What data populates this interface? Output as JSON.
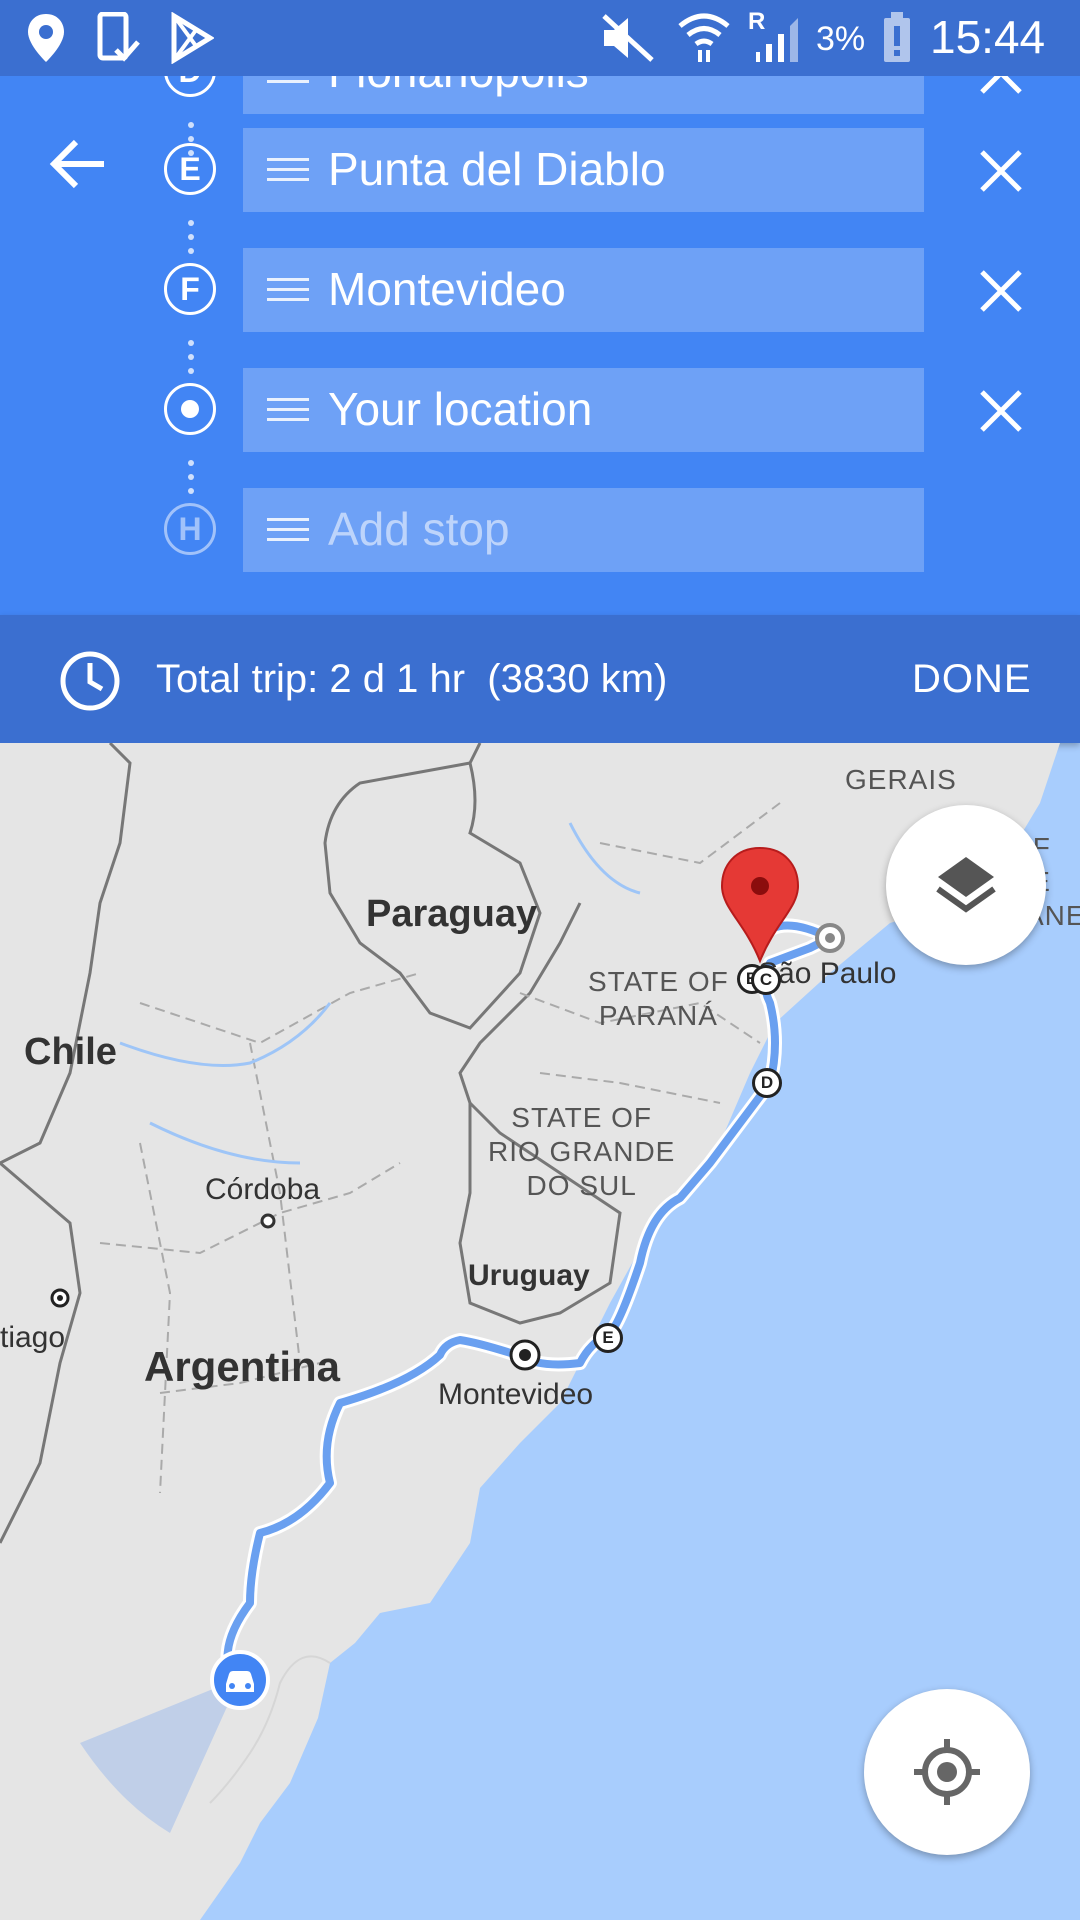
{
  "status_bar": {
    "battery": "3%",
    "time": "15:44",
    "network_indicator": "R"
  },
  "stops": {
    "partial": {
      "marker": "D",
      "label": "Florianópolis"
    },
    "items": [
      {
        "marker": "E",
        "label": "Punta del Diablo"
      },
      {
        "marker": "F",
        "label": "Montevideo"
      },
      {
        "marker": "",
        "label": "Your location"
      }
    ],
    "add_stop": {
      "marker": "H",
      "placeholder": "Add stop"
    }
  },
  "trip": {
    "summary": "Total trip: 2 d 1 hr  (3830 km)",
    "done_label": "DONE"
  },
  "map": {
    "countries": {
      "paraguay": "Paraguay",
      "chile": "Chile",
      "argentina": "Argentina",
      "uruguay": "Uruguay"
    },
    "states": {
      "parana_1": "STATE OF",
      "parana_2": "PARANÁ",
      "rgs_1": "STATE OF",
      "rgs_2": "RIO GRANDE",
      "rgs_3": "DO SUL",
      "gerais": "GERAIS",
      "rio_1": "OF",
      "rio_2": "DE",
      "rio_3": "JANEIRO"
    },
    "cities": {
      "cordoba": "Córdoba",
      "montevideo": "Montevideo",
      "sao_paulo": "São Paulo",
      "santiago": "tiago"
    },
    "route_markers": {
      "b": "B",
      "c": "C",
      "d": "D",
      "e": "E"
    }
  },
  "colors": {
    "panel": "#4285f4",
    "trip_bar": "#3b6fd0",
    "water": "#a8cdfd",
    "land": "#e5e5e5",
    "route": "#6aa0f0",
    "pin": "#e53935"
  }
}
